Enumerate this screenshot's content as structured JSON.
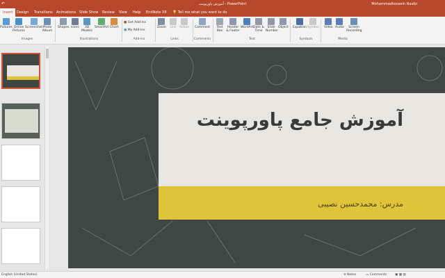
{
  "titlebar": {
    "title": "آموزش پاورپوینت - PowerPoint",
    "user": "Mohammadhossein Nasibi"
  },
  "tabs": [
    "Insert",
    "Design",
    "Transitions",
    "Animations",
    "Slide Show",
    "Review",
    "View",
    "Help",
    "EndNote X8"
  ],
  "tell_me": "Tell me what you want to do",
  "ribbon": {
    "groups": [
      {
        "label": "Images",
        "items": [
          "Pictures",
          "Online Pictures",
          "Screenshot",
          "Photo Album"
        ]
      },
      {
        "label": "Illustrations",
        "items": [
          "Shapes",
          "Icons",
          "3D Models",
          "SmartArt",
          "Chart"
        ]
      },
      {
        "label": "Add-ins",
        "items": [
          "Get Add-ins",
          "My Add-ins"
        ]
      },
      {
        "label": "Links",
        "items": [
          "Zoom",
          "Link",
          "Action"
        ]
      },
      {
        "label": "Comments",
        "items": [
          "Comment"
        ]
      },
      {
        "label": "Text",
        "items": [
          "Text Box",
          "Header & Footer",
          "WordArt",
          "Date & Time",
          "Slide Number",
          "Object"
        ]
      },
      {
        "label": "Symbols",
        "items": [
          "Equation",
          "Symbol"
        ]
      },
      {
        "label": "Media",
        "items": [
          "Video",
          "Audio",
          "Screen Recording"
        ]
      }
    ]
  },
  "slide": {
    "title": "آموزش جامع پاورپوینت",
    "subtitle": "مدرس: محمدحسین نصیبی"
  },
  "statusbar": {
    "language": "English (United States)",
    "notes": "Notes",
    "comments": "Comments"
  },
  "colors": {
    "accent": "#b7472a",
    "chalkboard": "#3f4745",
    "title_box": "#e7e6e0",
    "subtitle_box": "#dfc43a"
  }
}
